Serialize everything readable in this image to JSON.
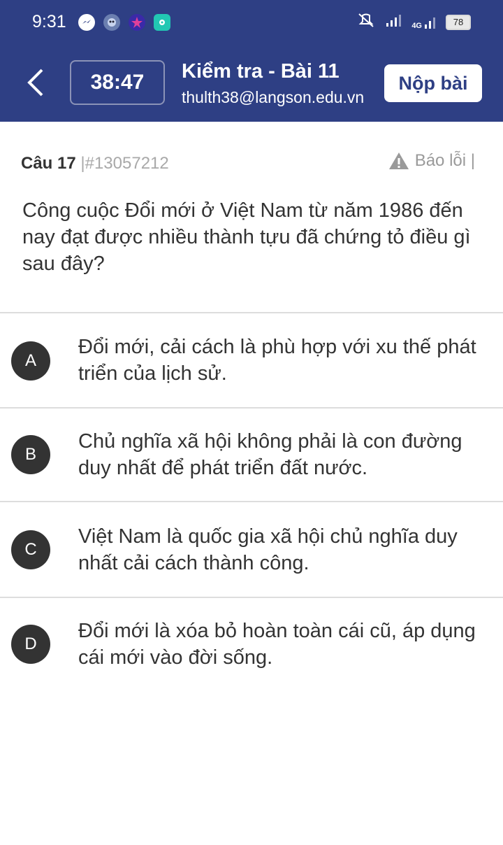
{
  "status_bar": {
    "time": "9:31",
    "network_label": "4G",
    "battery_level": "78",
    "icons": [
      "messenger-icon",
      "game-app-icon",
      "star-app-icon",
      "music-app-icon",
      "mute-icon",
      "signal-icon",
      "4g-signal-icon",
      "battery-icon"
    ]
  },
  "header": {
    "timer": "38:47",
    "title": "Kiểm tra -  Bài 11",
    "email": "thulth38@langson.edu.vn",
    "submit_label": "Nộp bài",
    "bg_color": "#2e3f84"
  },
  "question": {
    "number_label": "Câu 17",
    "id_label": "|#13057212",
    "report_label": "Báo lỗi |",
    "text": "Công cuộc Đổi mới ở Việt Nam từ năm 1986 đến nay đạt được nhiều thành tựu đã chứng tỏ điều gì sau đây?"
  },
  "options": [
    {
      "letter": "A",
      "text": "Đổi mới, cải cách là phù hợp với xu thế phát triển của lịch sử."
    },
    {
      "letter": "B",
      "text": "Chủ nghĩa xã hội không phải là con đường duy nhất để phát triển đất nước."
    },
    {
      "letter": "C",
      "text": "Việt Nam là quốc gia xã hội chủ nghĩa duy nhất cải cách thành công."
    },
    {
      "letter": "D",
      "text": "Đổi mới là xóa bỏ hoàn toàn cái cũ, áp dụng cái mới vào đời sống."
    }
  ]
}
